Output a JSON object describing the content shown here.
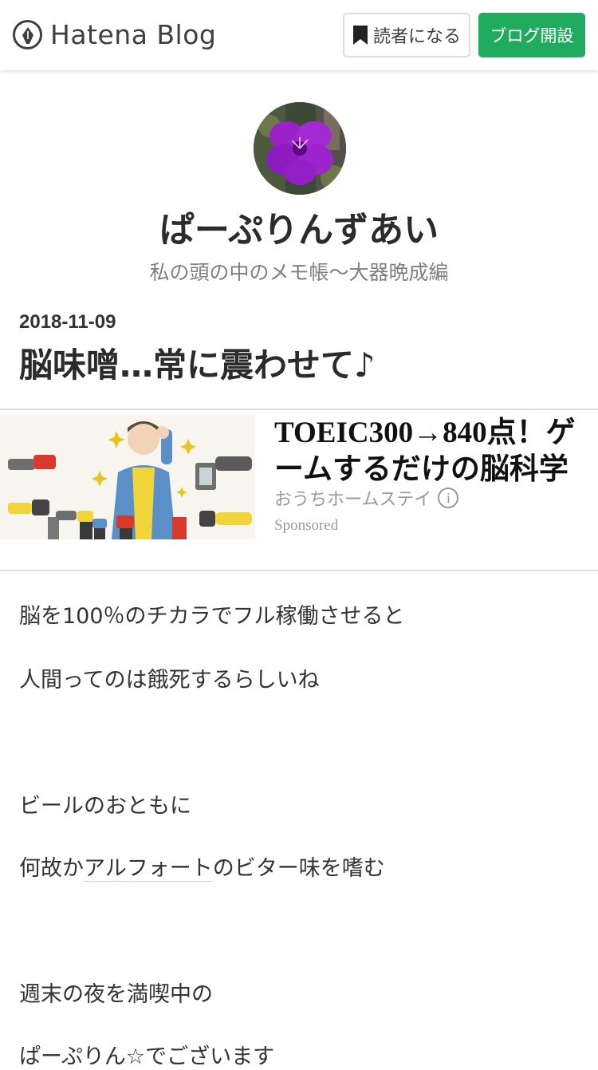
{
  "header": {
    "logo_text": "Hatena Blog",
    "subscribe_label": "読者になる",
    "create_blog_label": "ブログ開設",
    "accent_color": "#21ab5e"
  },
  "blog": {
    "title": "ぱーぷりんずあい",
    "description": "私の頭の中のメモ帳～大器晩成編",
    "avatar_icon": "purple-flower-photo"
  },
  "entry": {
    "date": "2018-11-09",
    "title": "脳味噌…常に震わせて♪"
  },
  "ad": {
    "headline": "TOEIC300→840点！ゲームするだけの脳科学",
    "advertiser": "おうちホームステイ",
    "info_icon": "i",
    "sponsored_label": "Sponsored"
  },
  "body": {
    "p1": "脳を100％のチカラでフル稼働させると",
    "p2": "人間ってのは餓死するらしいね",
    "p3": "ビールのおともに",
    "p4_before": "何故か",
    "p4_link": "アルフォート",
    "p4_after": "のビター味を嗜む",
    "p5": "週末の夜を満喫中の",
    "p6": "ぱーぷりん☆でございます"
  }
}
